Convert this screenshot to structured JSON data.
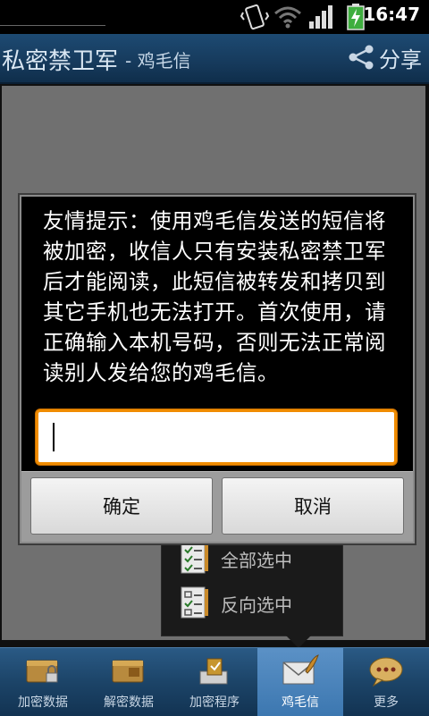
{
  "status_bar": {
    "time": "16:47",
    "icons": [
      "vibrate-icon",
      "wifi-icon",
      "signal-icon",
      "battery-charging-icon"
    ]
  },
  "header": {
    "title": "私密禁卫军",
    "subtitle": "- 鸡毛信",
    "share_label": "分享",
    "share_icon": "share-icon"
  },
  "popup_menu": {
    "items": [
      {
        "label": "全部选中",
        "icon": "checklist-icon"
      },
      {
        "label": "反向选中",
        "icon": "checklist-icon"
      }
    ]
  },
  "dialog": {
    "message": "友情提示：使用鸡毛信发送的短信将被加密，收信人只有安装私密禁卫军后才能阅读，此短信被转发和拷贝到其它手机也无法打开。首次使用，请正确输入本机号码，否则无法正常阅读别人发给您的鸡毛信。",
    "input_value": "",
    "ok_label": "确定",
    "cancel_label": "取消"
  },
  "tabs": [
    {
      "label": "加密数据",
      "icon": "encrypt-data-icon"
    },
    {
      "label": "解密数据",
      "icon": "decrypt-data-icon"
    },
    {
      "label": "加密程序",
      "icon": "encrypt-app-icon"
    },
    {
      "label": "鸡毛信",
      "icon": "envelope-icon",
      "active": true
    },
    {
      "label": "更多",
      "icon": "more-icon"
    }
  ],
  "colors": {
    "accent": "#f08c00",
    "header": "#163a5c",
    "tab_active": "#4a84bd"
  }
}
